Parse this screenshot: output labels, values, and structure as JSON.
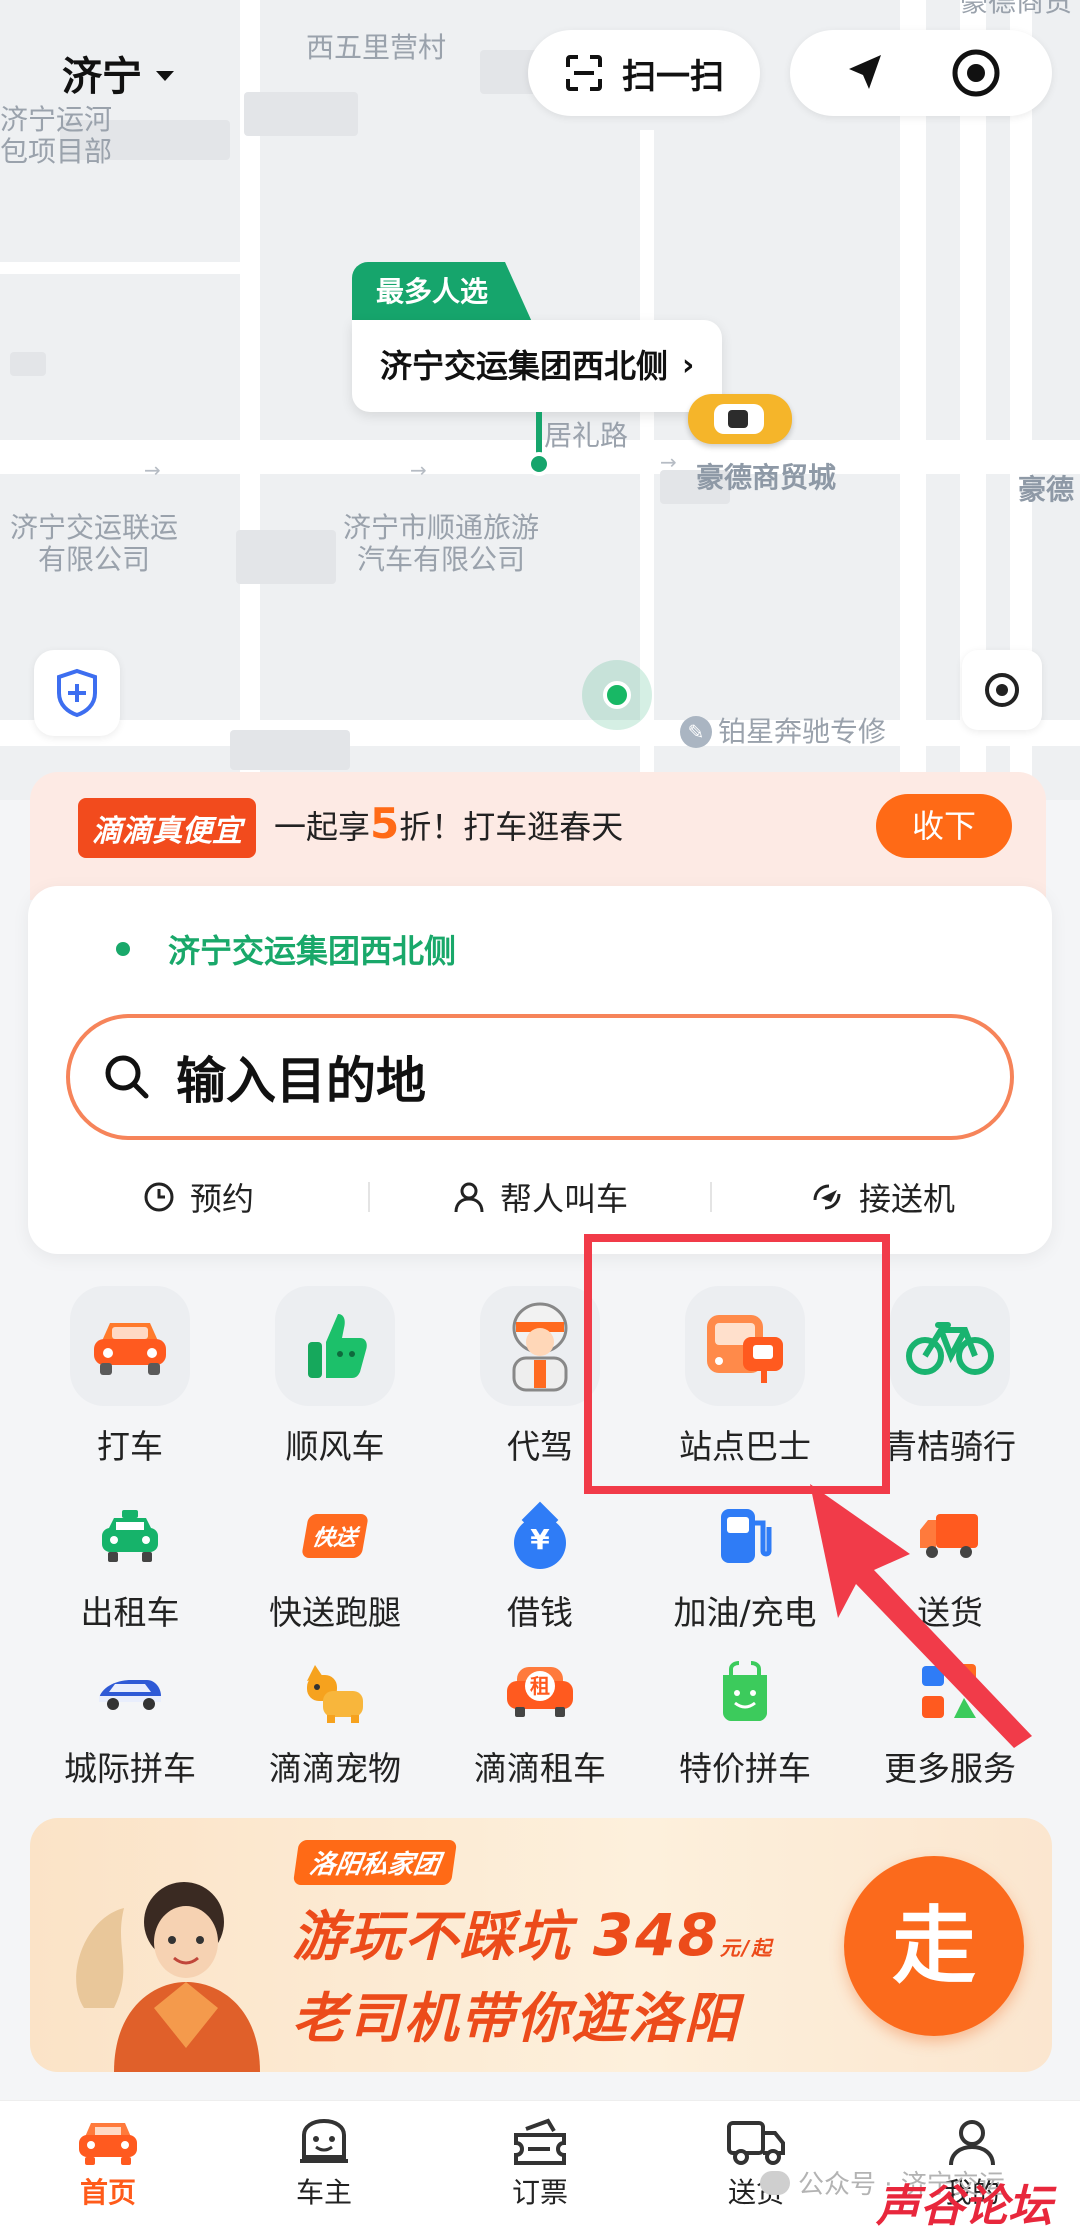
{
  "header": {
    "city": "济宁",
    "scan_label": "扫一扫"
  },
  "map": {
    "labels": {
      "village": "西五里营村",
      "canal_project_line1": "济宁运河",
      "canal_project_line2": "包项目部",
      "road": "居礼路",
      "mall": "豪德商贸城",
      "haode_right": "豪德",
      "haode_top": "豪德商贸",
      "transport_co_line1": "济宁交运联运",
      "transport_co_line2": "有限公司",
      "tour_co_line1": "济宁市顺通旅游",
      "tour_co_line2": "汽车有限公司",
      "repair": "铂星奔驰专修"
    },
    "pickup_tag": "最多人选",
    "pickup_name": "济宁交运集团西北侧"
  },
  "promo": {
    "badge": "滴滴真便宜",
    "text_before": "一起享",
    "text_highlight": "5",
    "text_after": "折！打车逛春天",
    "collapse_label": "收下"
  },
  "ride_card": {
    "origin": "济宁交运集团西北侧",
    "destination_placeholder": "输入目的地",
    "quick_actions": [
      {
        "label": "预约"
      },
      {
        "label": "帮人叫车"
      },
      {
        "label": "接送机"
      }
    ]
  },
  "services": {
    "row1": [
      {
        "label": "打车",
        "icon": "car-icon"
      },
      {
        "label": "顺风车",
        "icon": "thumbs-up-icon"
      },
      {
        "label": "代驾",
        "icon": "driver-icon"
      },
      {
        "label": "站点巴士",
        "icon": "bus-stop-icon"
      },
      {
        "label": "青桔骑行",
        "icon": "bicycle-icon"
      }
    ],
    "row2": [
      {
        "label": "出租车",
        "icon": "taxi-icon"
      },
      {
        "label": "快送跑腿",
        "icon": "express-icon",
        "icon_text": "快送"
      },
      {
        "label": "借钱",
        "icon": "loan-icon",
        "icon_text": "¥"
      },
      {
        "label": "加油/充电",
        "icon": "fuel-icon"
      },
      {
        "label": "送货",
        "icon": "truck-icon"
      }
    ],
    "row3": [
      {
        "label": "城际拼车",
        "icon": "intercity-car-icon"
      },
      {
        "label": "滴滴宠物",
        "icon": "pet-icon"
      },
      {
        "label": "滴滴租车",
        "icon": "rental-icon",
        "icon_text": "租"
      },
      {
        "label": "特价拼车",
        "icon": "discount-carpool-icon"
      },
      {
        "label": "更多服务",
        "icon": "more-services-icon"
      }
    ]
  },
  "banner": {
    "subtitle": "洛阳私家团",
    "line1": "游玩不踩坑",
    "price": "348",
    "price_unit": "元/起",
    "line2": "老司机带你逛洛阳",
    "cta": "走"
  },
  "bottom_nav": [
    {
      "label": "首页",
      "active": true
    },
    {
      "label": "车主"
    },
    {
      "label": "订票"
    },
    {
      "label": "送货"
    },
    {
      "label": "我的"
    }
  ],
  "watermark": {
    "text": "公众号 · 济宁交运",
    "logo_text": "声谷论坛"
  },
  "colors": {
    "accent_orange": "#ff6a16",
    "brand_green": "#16a56c",
    "highlight_red": "#f13b49"
  }
}
